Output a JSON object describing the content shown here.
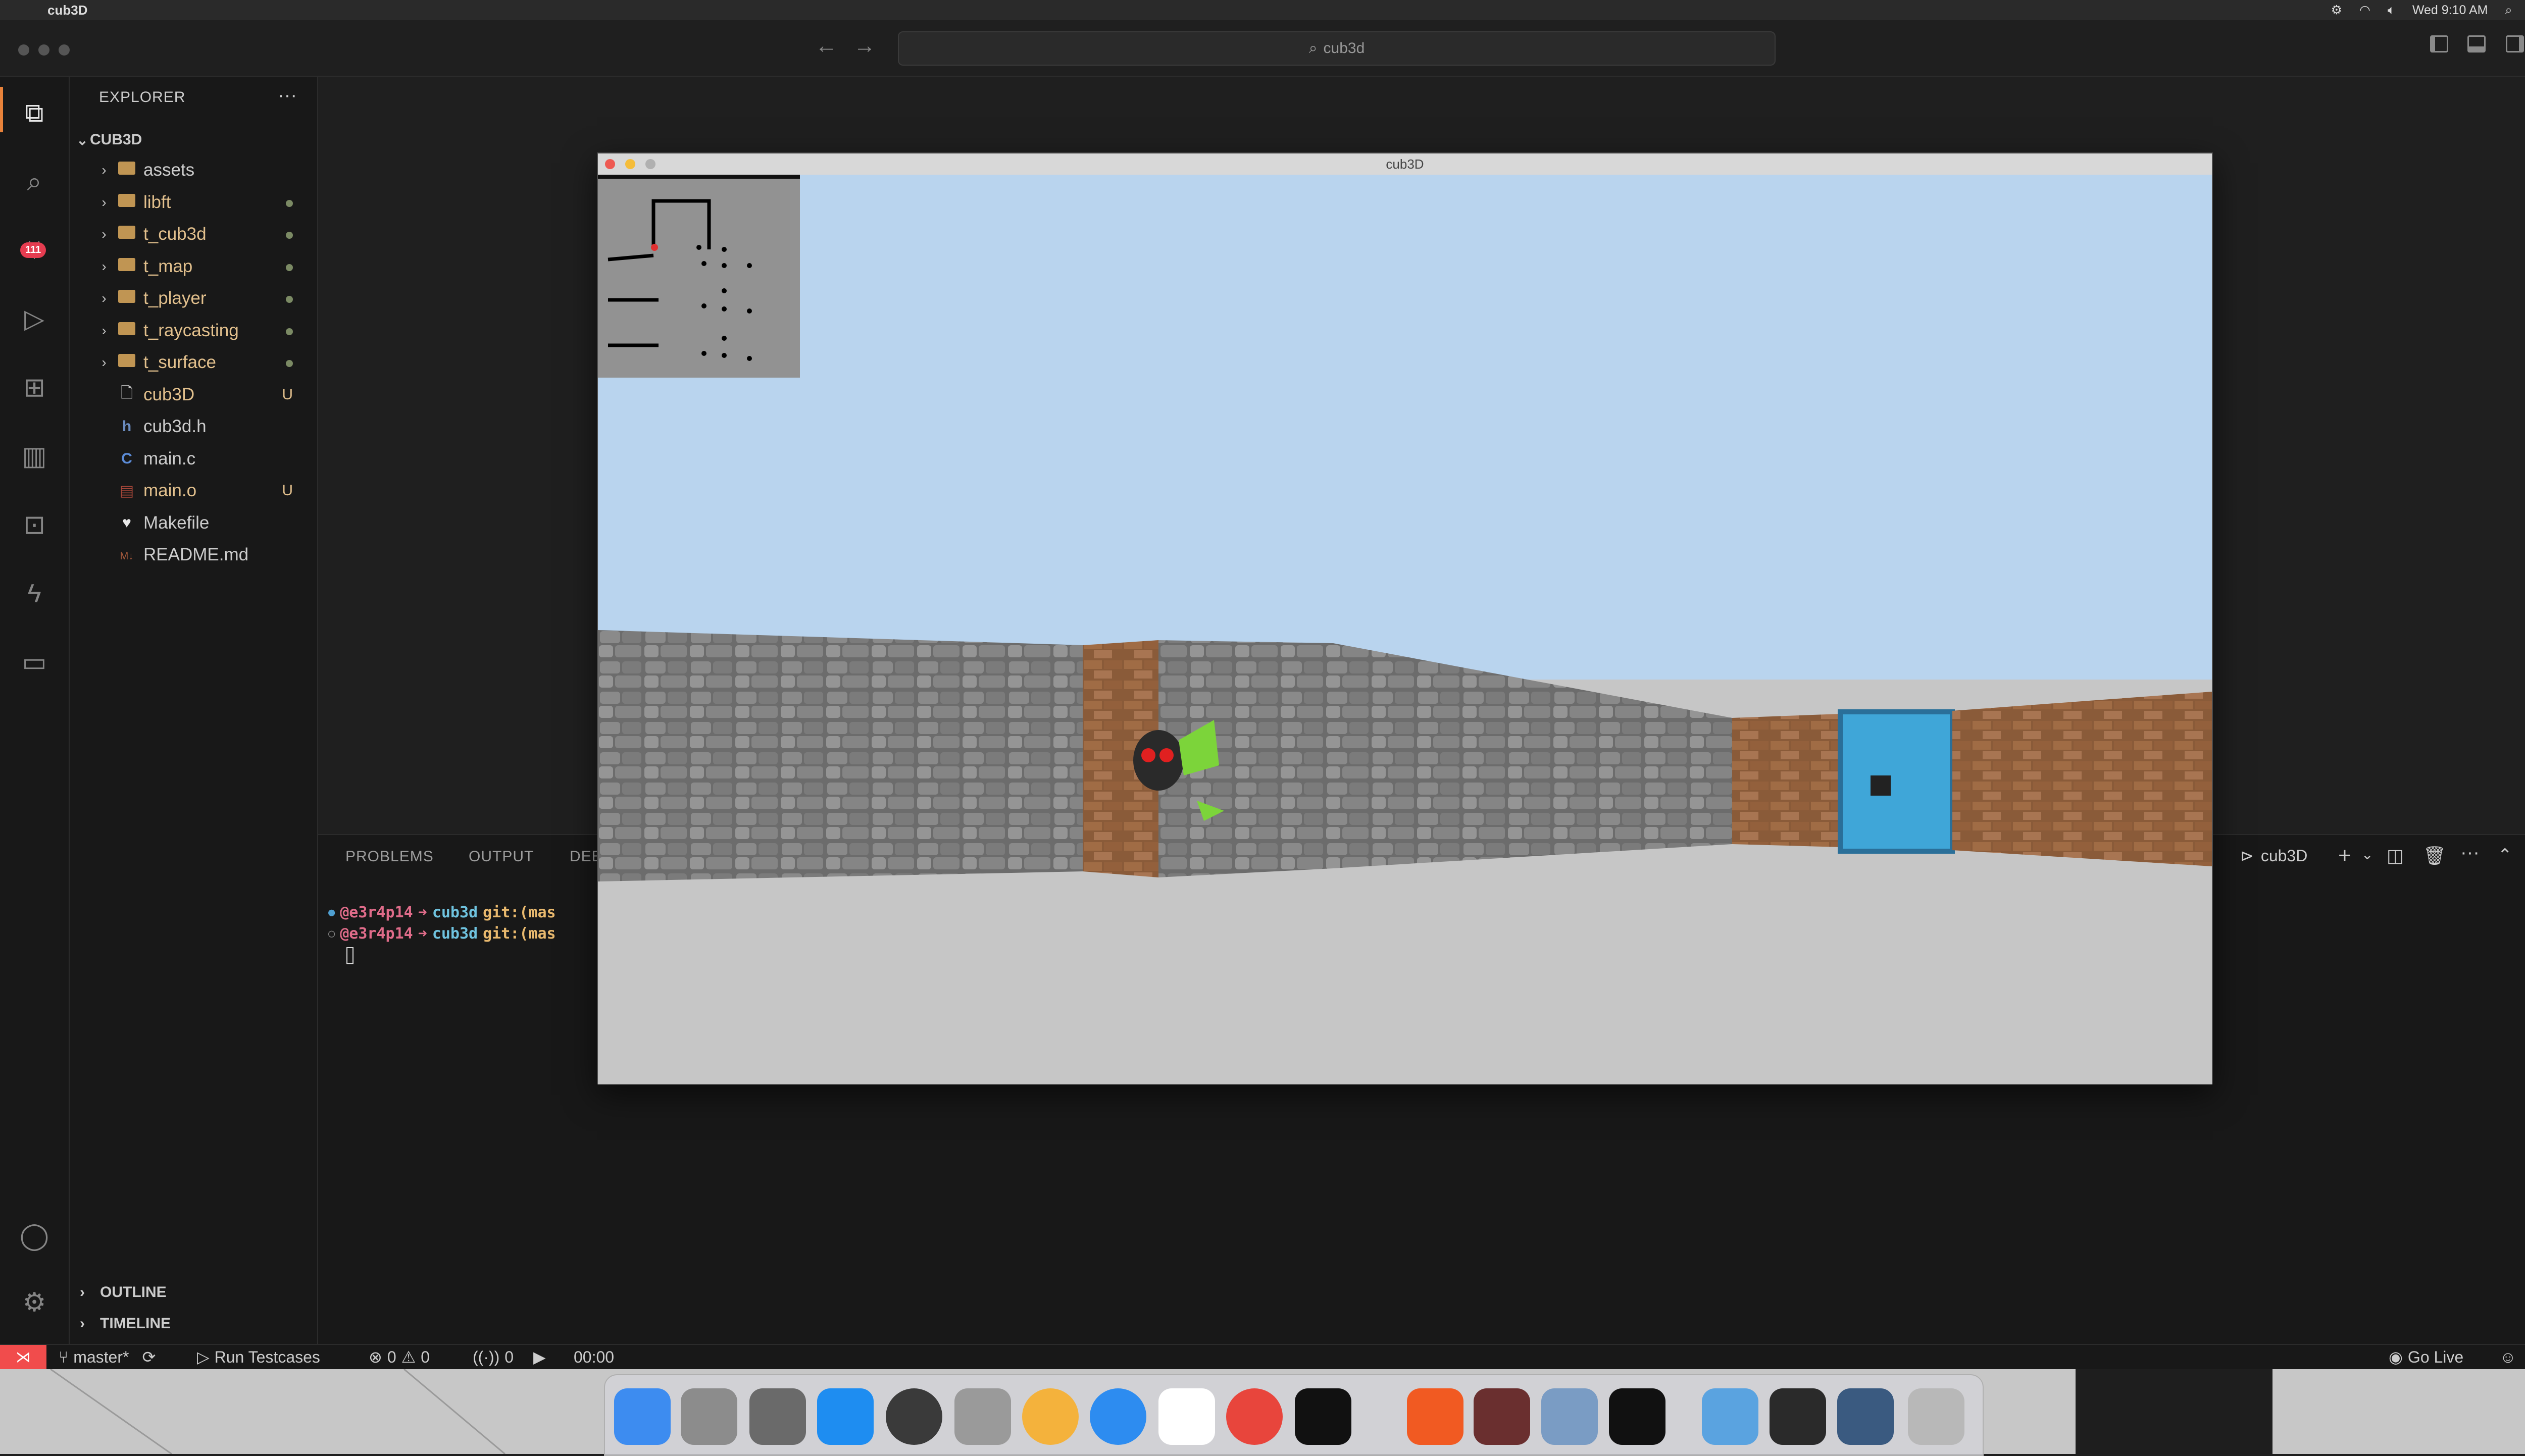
{
  "menubar": {
    "app_name": "cub3D",
    "clock": "Wed 9:10 AM"
  },
  "titlebar": {
    "search_text": "cub3d"
  },
  "activity": {
    "scm_badge": "111"
  },
  "explorer": {
    "title": "EXPLORER",
    "root": "CUB3D",
    "items": [
      {
        "label": "assets",
        "type": "folder",
        "status": ""
      },
      {
        "label": "libft",
        "type": "folder",
        "status": "dot"
      },
      {
        "label": "t_cub3d",
        "type": "folder",
        "status": "dot"
      },
      {
        "label": "t_map",
        "type": "folder",
        "status": "dot"
      },
      {
        "label": "t_player",
        "type": "folder",
        "status": "dot"
      },
      {
        "label": "t_raycasting",
        "type": "folder",
        "status": "dot"
      },
      {
        "label": "t_surface",
        "type": "folder",
        "status": "dot"
      },
      {
        "label": "cub3D",
        "type": "file",
        "status": "U"
      },
      {
        "label": "cub3d.h",
        "type": "header",
        "status": ""
      },
      {
        "label": "main.c",
        "type": "c",
        "status": ""
      },
      {
        "label": "main.o",
        "type": "obj",
        "status": "U"
      },
      {
        "label": "Makefile",
        "type": "makefile",
        "status": ""
      },
      {
        "label": "README.md",
        "type": "md",
        "status": ""
      }
    ],
    "outline": "OUTLINE",
    "timeline": "TIMELINE"
  },
  "panel": {
    "tabs": [
      "PROBLEMS",
      "OUTPUT",
      "DEBUG CONSOLE"
    ],
    "terminal_name": "cub3D",
    "lines": [
      {
        "user": "@e3r4p14",
        "arrow": "➜",
        "dir": "cub3d",
        "git": "git:(mas"
      },
      {
        "user": "@e3r4p14",
        "arrow": "➜",
        "dir": "cub3d",
        "git": "git:(mas"
      }
    ]
  },
  "statusbar": {
    "branch": "master*",
    "run_testcases": "Run Testcases",
    "errors": "0",
    "warnings": "0",
    "ports": "0",
    "timer": "00:00",
    "go_live": "Go Live"
  },
  "game_window": {
    "title": "cub3D"
  },
  "colors": {
    "sky": "#b9d4ee",
    "floor": "#c6c6c6",
    "accent": "#e8823a",
    "git_modified": "#e2c08d",
    "remote": "#f14c4c"
  }
}
